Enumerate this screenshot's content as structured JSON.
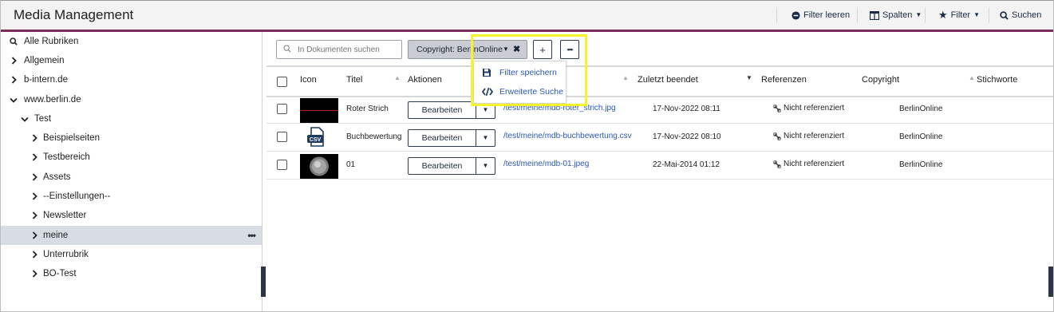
{
  "header": {
    "title": "Media Management",
    "buttons": {
      "clear_filter": "Filter leeren",
      "columns": "Spalten",
      "filter": "Filter",
      "search": "Suchen"
    }
  },
  "sidebar": {
    "items": [
      {
        "label": "Alle Rubriken",
        "icon": "search-icon"
      },
      {
        "label": "Allgemein",
        "icon": "chevron-right-icon"
      },
      {
        "label": "b-intern.de",
        "icon": "chevron-right-icon"
      },
      {
        "label": "www.berlin.de",
        "icon": "chevron-down-icon"
      },
      {
        "label": "Test",
        "icon": "chevron-down-icon"
      },
      {
        "label": "Beispielseiten",
        "icon": "chevron-right-icon"
      },
      {
        "label": "Testbereich",
        "icon": "chevron-right-icon"
      },
      {
        "label": "Assets",
        "icon": "chevron-right-icon"
      },
      {
        "label": "--Einstellungen--",
        "icon": "chevron-right-icon"
      },
      {
        "label": "Newsletter",
        "icon": "chevron-right-icon"
      },
      {
        "label": "meine",
        "icon": "chevron-right-icon"
      },
      {
        "label": "Unterrubrik",
        "icon": "chevron-right-icon"
      },
      {
        "label": "BO-Test",
        "icon": "chevron-right-icon"
      }
    ],
    "more_label": "•••"
  },
  "toolbar": {
    "search_placeholder": "In Dokumenten suchen",
    "filter_chip": "Copyright: BerlinOnline",
    "add_label": "+",
    "more_label": "•••"
  },
  "dropdown": {
    "items": [
      {
        "label": "Filter speichern",
        "icon": "save-icon"
      },
      {
        "label": "Erweiterte Suche",
        "icon": "code-icon"
      }
    ]
  },
  "table": {
    "headers": {
      "icon": "Icon",
      "title": "Titel",
      "actions": "Aktionen",
      "last_finished": "Zuletzt beendet",
      "references": "Referenzen",
      "copyright": "Copyright",
      "keywords": "Stichworte"
    },
    "rows": [
      {
        "title": "Roter Strich",
        "action": "Bearbeiten",
        "path": "/test/meine/mdb-roter_strich.jpg",
        "date": "17-Nov-2022 08:11",
        "ref": "Nicht referenziert",
        "copyright": "BerlinOnline",
        "thumb": "red-line"
      },
      {
        "title": "Buchbewertung",
        "action": "Bearbeiten",
        "path": "/test/meine/mdb-buchbewertung.csv",
        "date": "17-Nov-2022 08:10",
        "ref": "Nicht referenziert",
        "copyright": "BerlinOnline",
        "thumb": "csv-icon"
      },
      {
        "title": "01",
        "action": "Bearbeiten",
        "path": "/test/meine/mdb-01.jpeg",
        "date": "22-Mai-2014 01:12",
        "ref": "Nicht referenziert",
        "copyright": "BerlinOnline",
        "thumb": "coin"
      }
    ]
  },
  "colors": {
    "header_border": "#7a2c5a",
    "link": "#2a56b8",
    "active_row": "#d8dde4",
    "highlight": "#f5f52a"
  }
}
